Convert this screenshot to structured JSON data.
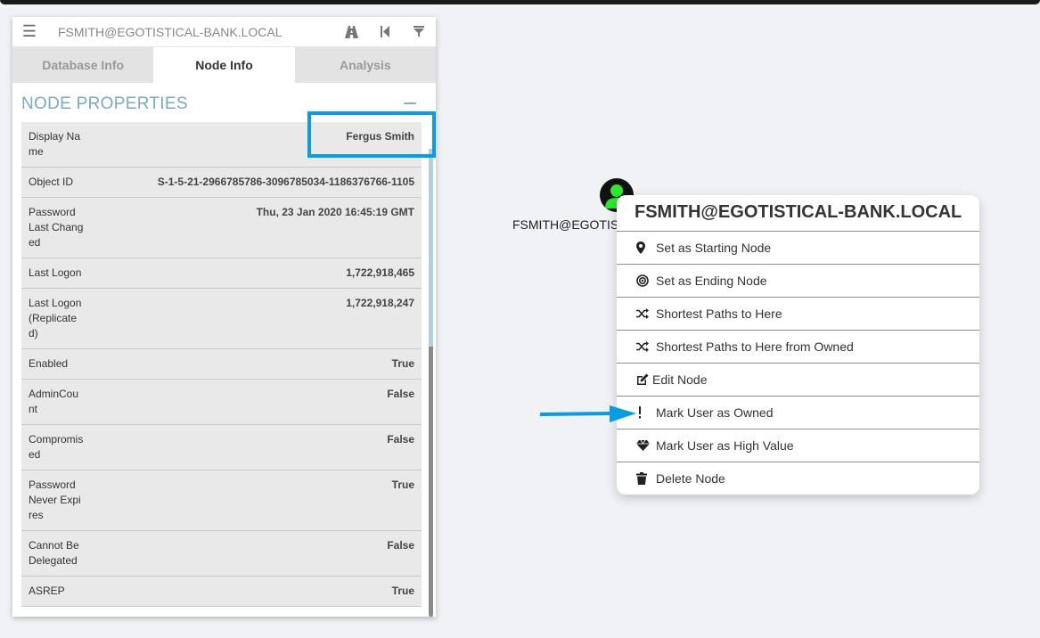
{
  "search": {
    "value": "FSMITH@EGOTISTICAL-BANK.LOCAL"
  },
  "tabs": [
    {
      "label": "Database Info"
    },
    {
      "label": "Node Info"
    },
    {
      "label": "Analysis"
    }
  ],
  "properties": {
    "header": "NODE PROPERTIES",
    "rows": [
      {
        "label": "Display Name",
        "value": "Fergus Smith"
      },
      {
        "label": "Object ID",
        "value": "S-1-5-21-2966785786-3096785034-1186376766-1105"
      },
      {
        "label": "Password Last Changed",
        "value": "Thu, 23 Jan 2020 16:45:19 GMT"
      },
      {
        "label": "Last Logon",
        "value": "1,722,918,465"
      },
      {
        "label": "Last Logon (Replicated)",
        "value": "1,722,918,247"
      },
      {
        "label": "Enabled",
        "value": "True"
      },
      {
        "label": "AdminCount",
        "value": "False"
      },
      {
        "label": "Compromised",
        "value": "False"
      },
      {
        "label": "Password Never Expires",
        "value": "True"
      },
      {
        "label": "Cannot Be Delegated",
        "value": "False"
      },
      {
        "label": "ASREP",
        "value": "True"
      }
    ]
  },
  "node": {
    "label": "FSMITH@EGOTISTICAL-BANK.LOCAL"
  },
  "context_menu": {
    "title": "FSMITH@EGOTISTICAL-BANK.LOCAL",
    "items": [
      {
        "label": "Set as Starting Node",
        "icon": "map-marker-icon"
      },
      {
        "label": "Set as Ending Node",
        "icon": "bullseye-icon"
      },
      {
        "label": "Shortest Paths to Here",
        "icon": "random-icon"
      },
      {
        "label": "Shortest Paths to Here from Owned",
        "icon": "random-icon"
      },
      {
        "label": "Edit Node",
        "icon": "edit-icon"
      },
      {
        "label": "Mark User as Owned",
        "icon": "exclamation-icon"
      },
      {
        "label": "Mark User as High Value",
        "icon": "gem-icon"
      },
      {
        "label": "Delete Node",
        "icon": "trash-icon"
      }
    ]
  },
  "colors": {
    "accent": "#0a9be0",
    "header": "#7aa8c6",
    "node_icon": "#2ee82e"
  }
}
